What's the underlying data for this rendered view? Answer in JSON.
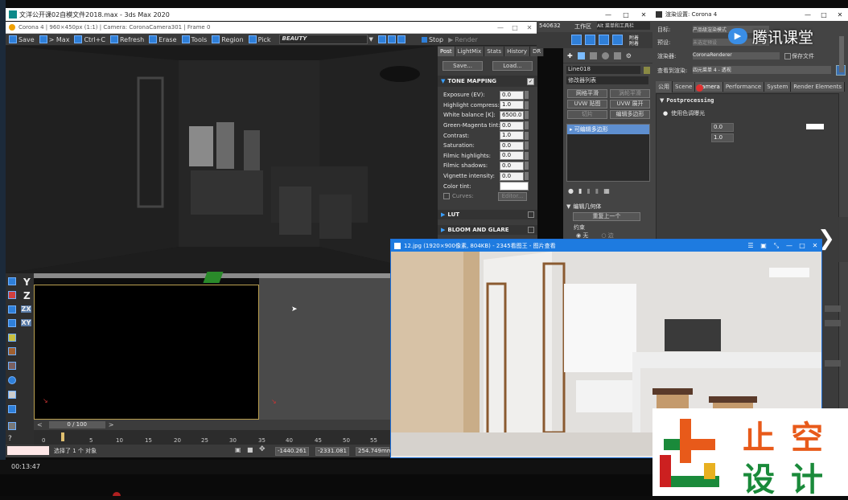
{
  "max_title": "文洋公开课02自模文件2018.max - 3ds Max 2020",
  "vfb": {
    "title": "Corona 4 | 960×450px (1:1) | Camera: CoronaCamera301 | Frame 0",
    "save": "Save",
    "to_max": "> Max",
    "ctrl_c": "Ctrl+C",
    "refresh": "Refresh",
    "erase": "Erase",
    "tools": "Tools",
    "region": "Region",
    "pick": "Pick",
    "channel": "BEAUTY",
    "stop": "Stop",
    "render": "Render",
    "tabs": [
      "Post",
      "LightMix",
      "Stats",
      "History",
      "DR"
    ],
    "save_btn": "Save...",
    "load_btn": "Load...",
    "tone_mapping": "TONE MAPPING",
    "tm_rows": [
      {
        "label": "Exposure (EV):",
        "value": "0.0"
      },
      {
        "label": "Highlight compress:",
        "value": "1.0"
      },
      {
        "label": "White balance [K]:",
        "value": "6500.0"
      },
      {
        "label": "Green-Magenta tint:",
        "value": "0.0"
      },
      {
        "label": "Contrast:",
        "value": "1.0"
      },
      {
        "label": "Saturation:",
        "value": "0.0"
      },
      {
        "label": "Filmic highlights:",
        "value": "0.0"
      },
      {
        "label": "Filmic shadows:",
        "value": "0.0"
      },
      {
        "label": "Vignette intensity:",
        "value": "0.0"
      }
    ],
    "color_tint": "Color tint:",
    "curves": "Curves:",
    "editor": "Editor...",
    "lut": "LUT",
    "bloom": "BLOOM AND GLARE"
  },
  "max_ui": {
    "num_field": "540632",
    "workspace": "工作区",
    "workspace_val": "Alt 菜单和工具栏",
    "rows": [
      "附着",
      "附着",
      "附着"
    ],
    "obj_name": "Line018",
    "modifier_list": "修改器列表",
    "mod_btns": [
      "网格平滑",
      "涡轮平滑",
      "UVW 贴图",
      "UVW 展开",
      "切片",
      "编辑多边形"
    ],
    "stack_item": "可编辑多边形",
    "edit_geometry": "编辑几何体",
    "repeat_last": "重复上一个",
    "constraints": "约束",
    "none_label": "无",
    "edge_label": "边",
    "axes": [
      "Y",
      "Z",
      "ZX",
      "XY"
    ],
    "frame_counter": "0 / 100",
    "ruler": [
      "0",
      "5",
      "10",
      "15",
      "20",
      "25",
      "30",
      "35",
      "40",
      "45",
      "50",
      "55"
    ],
    "status_selected": "选择了 1 个 对象",
    "coord_x": "-1440.261",
    "coord_y": "-2331.081",
    "coord_z": "254.749mm",
    "time": "00:13:47"
  },
  "render_setup": {
    "title": "渲染设置: Corona 4",
    "target_label": "目标:",
    "target_val": "产品级渲染模式",
    "preset_label": "预设:",
    "preset_val": "未选定预设",
    "renderer_label": "渲染器:",
    "renderer_val": "CoronaRenderer",
    "save_file": "保存文件",
    "view_label": "查看到渲染:",
    "view_val": "四元菜单 4 - 透视",
    "tabs": [
      "公用",
      "Scene",
      "Camera",
      "Performance",
      "System",
      "Render Elements"
    ],
    "postprocessing": "Postprocessing",
    "use_tm": "使用色调曝光",
    "v1": "0.0",
    "v2": "1.0"
  },
  "tencent": {
    "logo_text": "腾讯课堂"
  },
  "image_viewer": {
    "title": "12.jpg  (1920×900像素, 804KB) - 2345看图王 - 图片查看",
    "overlay": "2345看图王 - 图片查看器"
  },
  "brand": {
    "line1": "止空",
    "line2": "设计"
  }
}
